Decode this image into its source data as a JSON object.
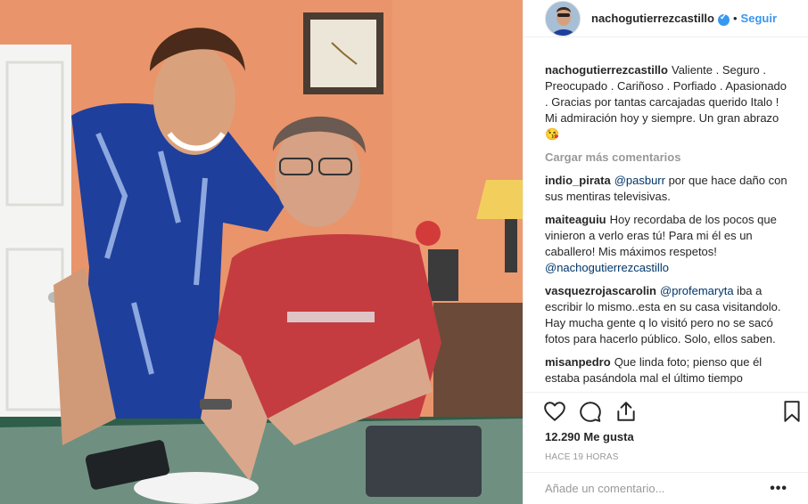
{
  "header": {
    "username": "nachogutierrezcastillo",
    "separator": "•",
    "follow_label": "Seguir"
  },
  "caption": {
    "username": "nachogutierrezcastillo",
    "text": "Valiente . Seguro . Preocupado . Cariñoso . Porfiado . Apasionado . Gracias por tantas carcajadas querido Italo ! Mi admiración hoy y siempre. Un gran abrazo 😘"
  },
  "load_more_label": "Cargar más comentarios",
  "comments": [
    {
      "username": "indio_pirata",
      "mention": "@pasburr",
      "text": " por que hace daño con sus mentiras televisivas."
    },
    {
      "username": "maiteaguiu",
      "mention": "",
      "text": "Hoy recordaba de los pocos que vinieron a verlo eras tú! Para mi él es un caballero! Mis máximos respetos!",
      "mention_end": "@nachogutierrezcastillo"
    },
    {
      "username": "vasquezrojascarolin",
      "mention": "@profemaryta",
      "text": " iba a escribir lo mismo..esta en su casa visitandolo. Hay mucha gente q lo visitó pero no se sacó fotos para hacerlo público. Solo, ellos saben."
    },
    {
      "username": "misanpedro",
      "mention": "",
      "text": "Que linda foto; pienso que él estaba pasándola mal el último tiempo"
    }
  ],
  "likes": "12.290 Me gusta",
  "timestamp": "Hace 19 horas",
  "add_comment": {
    "placeholder": "Añade un comentario..."
  },
  "options_label": "•••",
  "icons": [
    "heart-icon",
    "comment-icon",
    "share-icon",
    "bookmark-icon",
    "verified-icon"
  ],
  "colors": {
    "link": "#3897f0",
    "mention": "#003569",
    "muted": "#999999",
    "wall": "#e8976c"
  }
}
